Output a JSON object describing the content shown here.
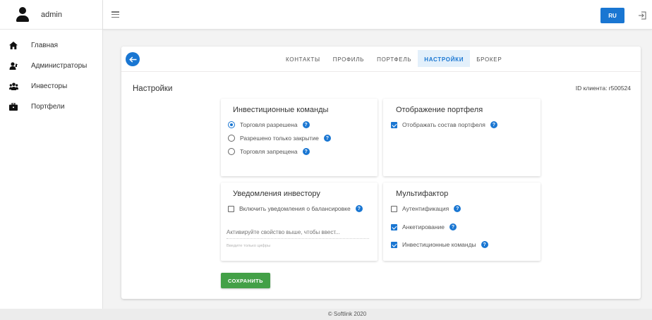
{
  "user": {
    "name": "admin"
  },
  "sidebar": {
    "items": [
      {
        "label": "Главная",
        "icon": "home-icon"
      },
      {
        "label": "Администраторы",
        "icon": "admins-icon"
      },
      {
        "label": "Инвесторы",
        "icon": "investors-icon"
      },
      {
        "label": "Портфели",
        "icon": "briefcase-icon"
      }
    ]
  },
  "topbar": {
    "lang_label": "RU",
    "accent_color": "#1976d2"
  },
  "tabs": [
    {
      "label": "КОНТАКТЫ",
      "active": false
    },
    {
      "label": "ПРОФИЛЬ",
      "active": false
    },
    {
      "label": "ПОРТФЕЛЬ",
      "active": false
    },
    {
      "label": "НАСТРОЙКИ",
      "active": true
    },
    {
      "label": "БРОКЕР",
      "active": false
    }
  ],
  "settings": {
    "title": "Настройки",
    "client_id": "ID клиента: r500524"
  },
  "panels": {
    "investment_commands": {
      "title": "Инвестиционные команды",
      "options": [
        {
          "label": "Торговля разрешена",
          "selected": true
        },
        {
          "label": "Разрешено только закрытие",
          "selected": false
        },
        {
          "label": "Торговля запрещена",
          "selected": false
        }
      ]
    },
    "portfolio_display": {
      "title": "Отображение портфеля",
      "options": [
        {
          "label": "Отображать состав портфеля",
          "checked": true
        }
      ]
    },
    "investor_notifications": {
      "title": "Уведомления инвестору",
      "options": [
        {
          "label": "Включить уведомления о балансировке",
          "checked": false
        }
      ],
      "input_placeholder": "Активируйте свойство выше, чтобы ввест...",
      "input_hint": "Введите только цифры"
    },
    "multifactor": {
      "title": "Мультифактор",
      "options": [
        {
          "label": "Аутентификация",
          "checked": false
        },
        {
          "label": "Анкетирование",
          "checked": true
        },
        {
          "label": "Инвестиционные команды",
          "checked": true
        }
      ]
    }
  },
  "help_glyph": "?",
  "save_label": "СОХРАНИТЬ",
  "save_color": "#43a047",
  "footer": {
    "text": "© Softlink 2020"
  }
}
